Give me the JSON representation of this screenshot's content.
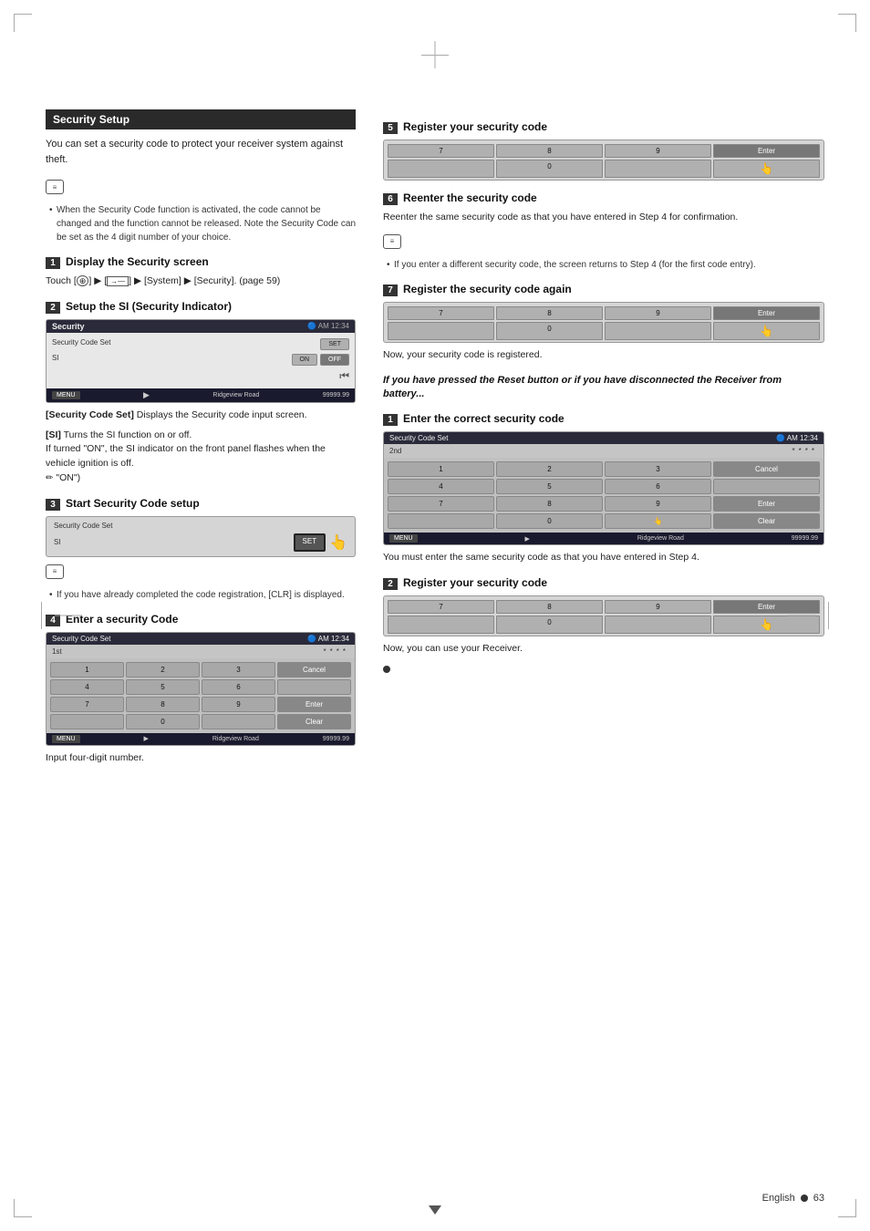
{
  "page": {
    "title": "Security Setup",
    "intro": "You can set a security code to protect your receiver system against theft.",
    "footer": {
      "language": "English",
      "page_num": "63"
    }
  },
  "left": {
    "note1": {
      "bullets": [
        "When the Security Code function is activated, the code cannot be changed and the function cannot be released. Note the Security Code can be set as the 4 digit number of your choice."
      ]
    },
    "step1": {
      "num": "1",
      "title": "Display the Security screen",
      "content": "Touch [   ] ▶ [      ] ▶ [System] ▶ [Security]. (page 59)"
    },
    "step2": {
      "num": "2",
      "title": "Setup the SI (Security Indicator)",
      "screen": {
        "title": "Security",
        "label": "Security Code Set",
        "si_label": "SI",
        "btn_set": "SET",
        "btn_on": "ON",
        "btn_off": "OFF",
        "road": "Ridgeview Road",
        "mileage": "99999.99"
      },
      "desc1_key": "[Security Code Set]",
      "desc1_val": "  Displays the Security code input screen.",
      "desc2_key": "[SI]",
      "desc2_val": "  Turns the SI function on or off.\n  If turned \"ON\", the SI indicator on the front panel flashes when the vehicle ignition is off.",
      "desc2_note": "\"ON\")"
    },
    "step3": {
      "num": "3",
      "title": "Start Security Code setup",
      "screen": {
        "label": "Security Code Set",
        "si_label": "SI",
        "btn_set": "SET"
      },
      "note_bullets": [
        "If you have already completed the code registration, [CLR] is displayed."
      ]
    },
    "step4": {
      "num": "4",
      "title": "Enter a security Code",
      "screen": {
        "title": "Security Code Set",
        "tab": "1st",
        "entry": "****",
        "keys": [
          "1",
          "2",
          "3",
          "Cancel",
          "4",
          "5",
          "6",
          "",
          "7",
          "8",
          "9",
          "Enter",
          "",
          "0",
          "",
          "Clear"
        ],
        "road": "Ridgeview Road",
        "mileage": "99999.99"
      },
      "content": "Input four-digit number."
    }
  },
  "right": {
    "step5": {
      "num": "5",
      "title": "Register your security code",
      "screen": {
        "keys_top": [
          "7",
          "8",
          "9",
          "Enter"
        ],
        "keys_bot": [
          "",
          "0",
          "",
          ""
        ]
      }
    },
    "step6": {
      "num": "6",
      "title": "Reenter the security code",
      "content": "Reenter the same security code as that you have entered in Step 4 for confirmation.",
      "note_bullets": [
        "If you enter a different security code, the screen returns to Step 4 (for the first code entry)."
      ]
    },
    "step7": {
      "num": "7",
      "title": "Register the security code again",
      "screen": {
        "keys_top": [
          "7",
          "8",
          "9",
          "Enter"
        ],
        "keys_bot": [
          "",
          "0",
          "",
          ""
        ]
      },
      "content": "Now, your security code is registered."
    },
    "reset_section": {
      "header": "If you have pressed the Reset button or if you have disconnected the Receiver from battery...",
      "step1": {
        "num": "1",
        "title": "Enter the correct security code",
        "screen": {
          "title": "Security Code Set",
          "tab": "2nd",
          "entry": "****",
          "keys": [
            "1",
            "2",
            "3",
            "Cancel",
            "4",
            "5",
            "6",
            "",
            "7",
            "8",
            "9",
            "Enter",
            "",
            "0",
            "",
            "Clear"
          ],
          "road": "Ridgeview Road",
          "mileage": "99999.99"
        },
        "content": "You must enter the same security code as that you have entered in Step 4."
      },
      "step2": {
        "num": "2",
        "title": "Register your security code",
        "screen": {
          "keys_top": [
            "7",
            "8",
            "9",
            "Enter"
          ],
          "keys_bot": [
            "",
            "0",
            "",
            ""
          ]
        },
        "content": "Now, you can use your Receiver."
      }
    }
  }
}
